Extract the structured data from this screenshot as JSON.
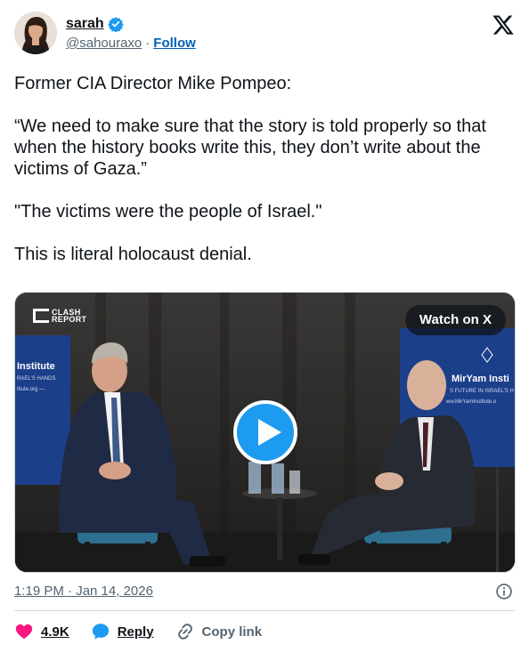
{
  "author": {
    "name": "sarah",
    "handle": "@sahouraxo",
    "separator": "·",
    "follow_label": "Follow",
    "verified": true
  },
  "icons": {
    "verified": "verified-badge-icon",
    "platform": "x-logo-icon",
    "play": "play-icon",
    "info": "info-icon",
    "like": "heart-icon",
    "reply": "speech-bubble-icon",
    "copy": "link-icon"
  },
  "tweet": {
    "paragraphs": [
      "Former CIA Director Mike Pompeo:",
      "“We need to make sure that the story is told properly so that when the history books write this, they don’t write about the victims of Gaza.”",
      "\"The victims were the people of Israel.\"",
      "This is literal holocaust denial."
    ]
  },
  "media": {
    "watermark_line1": "CLASH",
    "watermark_line2": "REPORT",
    "watch_label": "Watch on X",
    "banner_left_title": "Institute",
    "banner_left_sub": "RAEL'S HANDS",
    "banner_left_url": "titute.org —",
    "banner_right_title": "MirYam Insti",
    "banner_right_sub": "S FUTURE IN ISRAEL'S H",
    "banner_right_url": "ww.MirYamInstitute.o"
  },
  "meta": {
    "timestamp": "1:19 PM · Jan 14, 2026"
  },
  "actions": {
    "like_count": "4.9K",
    "reply_label": "Reply",
    "copy_label": "Copy link"
  },
  "colors": {
    "link_blue": "#0060b8",
    "like_red": "#f91880",
    "reply_blue": "#1d9bf0",
    "muted": "#536471",
    "verified_blue": "#1d9bf0"
  }
}
